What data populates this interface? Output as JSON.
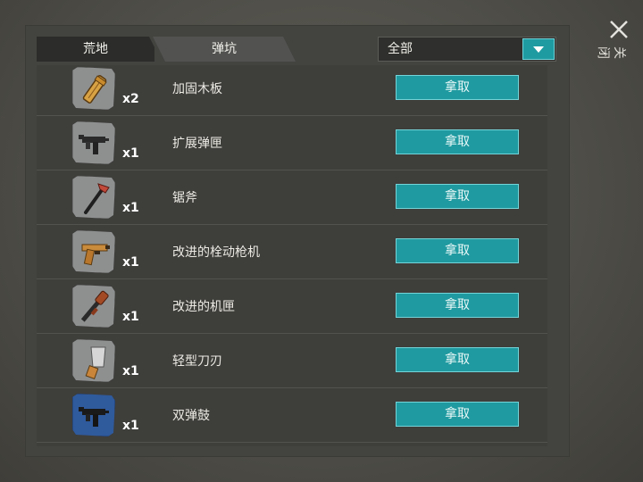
{
  "tabs": [
    {
      "label": "荒地",
      "active": true
    },
    {
      "label": "弹坑",
      "active": false
    }
  ],
  "filter": {
    "selected": "全部",
    "icon": "chevron-down-icon"
  },
  "close": {
    "label": "关闭",
    "icon": "close-icon"
  },
  "colors": {
    "accent": "#1f9aa0",
    "panel": "#434340",
    "row": "#3e3e3b"
  },
  "items": [
    {
      "name": "加固木板",
      "qty": "x2",
      "action": "拿取",
      "icon": "plank-icon",
      "rarity": "common"
    },
    {
      "name": "扩展弹匣",
      "qty": "x1",
      "action": "拿取",
      "icon": "smg-icon",
      "rarity": "common"
    },
    {
      "name": "锯斧",
      "qty": "x1",
      "action": "拿取",
      "icon": "axe-icon",
      "rarity": "common"
    },
    {
      "name": "改进的栓动枪机",
      "qty": "x1",
      "action": "拿取",
      "icon": "pistol-icon",
      "rarity": "common"
    },
    {
      "name": "改进的机匣",
      "qty": "x1",
      "action": "拿取",
      "icon": "shotgun-icon",
      "rarity": "common"
    },
    {
      "name": "轻型刀刃",
      "qty": "x1",
      "action": "拿取",
      "icon": "cleaver-icon",
      "rarity": "common"
    },
    {
      "name": "双弹鼓",
      "qty": "x1",
      "action": "拿取",
      "icon": "smg-icon",
      "rarity": "blue"
    }
  ]
}
